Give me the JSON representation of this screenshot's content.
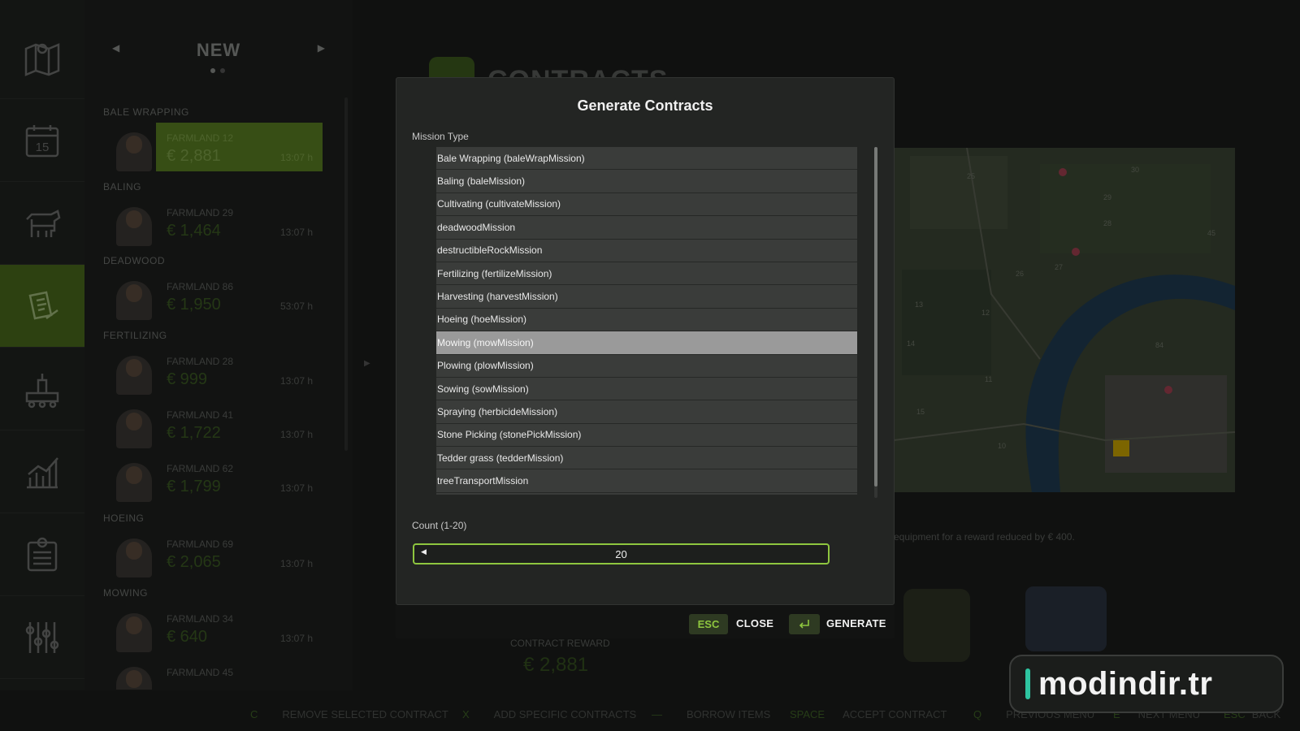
{
  "background": {
    "nav_icons": [
      "map-icon",
      "calendar-icon",
      "animals-icon",
      "contracts-icon",
      "production-icon",
      "statistics-icon",
      "finance-icon",
      "settings-icon"
    ],
    "calendar_day": "15",
    "panel": {
      "title": "NEW",
      "categories": [
        "BALE WRAPPING",
        "BALING",
        "DEADWOOD",
        "FERTILIZING",
        "HOEING",
        "MOWING"
      ],
      "entries": [
        {
          "farm": "FARMLAND 12",
          "reward": "€ 2,881",
          "time": "13:07 h"
        },
        {
          "farm": "FARMLAND 29",
          "reward": "€ 1,464",
          "time": "13:07 h"
        },
        {
          "farm": "FARMLAND 86",
          "reward": "€ 1,950",
          "time": "53:07 h"
        },
        {
          "farm": "FARMLAND 28",
          "reward": "€ 999",
          "time": "13:07 h"
        },
        {
          "farm": "FARMLAND 41",
          "reward": "€ 1,722",
          "time": "13:07 h"
        },
        {
          "farm": "FARMLAND 62",
          "reward": "€ 1,799",
          "time": "13:07 h"
        },
        {
          "farm": "FARMLAND 69",
          "reward": "€ 2,065",
          "time": "13:07 h"
        },
        {
          "farm": "FARMLAND 34",
          "reward": "€ 640",
          "time": "13:07 h"
        },
        {
          "farm": "FARMLAND 45",
          "reward": "",
          "time": ""
        }
      ]
    },
    "contracts_heading": "CONTRACTS",
    "info_text": "equipment for a reward reduced by € 400.",
    "contract_reward_label": "CONTRACT REWARD",
    "contract_reward_value": "€ 2,881",
    "map_numbers": [
      "25",
      "30",
      "29",
      "28",
      "45",
      "26",
      "27",
      "13",
      "12",
      "14",
      "84",
      "11",
      "15",
      "10"
    ],
    "hints": [
      {
        "key": "C",
        "label": "REMOVE SELECTED CONTRACT"
      },
      {
        "key": "X",
        "label": "ADD SPECIFIC CONTRACTS"
      },
      {
        "key": "—",
        "label": "BORROW ITEMS"
      },
      {
        "key": "SPACE",
        "label": "ACCEPT CONTRACT"
      },
      {
        "key": "Q",
        "label": "PREVIOUS MENU"
      },
      {
        "key": "E",
        "label": "NEXT MENU"
      },
      {
        "key": "ESC",
        "label": "BACK"
      }
    ]
  },
  "modal": {
    "title": "Generate Contracts",
    "mission_type_label": "Mission Type",
    "missions": [
      "Bale Wrapping (baleWrapMission)",
      "Baling (baleMission)",
      "Cultivating (cultivateMission)",
      "deadwoodMission",
      "destructibleRockMission",
      "Fertilizing (fertilizeMission)",
      "Harvesting (harvestMission)",
      "Hoeing (hoeMission)",
      "Mowing (mowMission)",
      "Plowing (plowMission)",
      "Sowing (sowMission)",
      "Spraying (herbicideMission)",
      "Stone Picking (stonePickMission)",
      "Tedder grass (tedderMission)",
      "treeTransportMission",
      ""
    ],
    "selected_mission": "Mowing (mowMission)",
    "count_label": "Count (1-20)",
    "count_value": "20",
    "close_key": "ESC",
    "close_label": "CLOSE",
    "generate_key_icon": "enter-icon",
    "generate_label": "GENERATE"
  },
  "watermark": "modindir.tr",
  "colors": {
    "accent": "#8ec63f",
    "selected_row": "#9a9a9a",
    "row": "#3a3c3a",
    "nav_active": "#4a6a1c"
  }
}
